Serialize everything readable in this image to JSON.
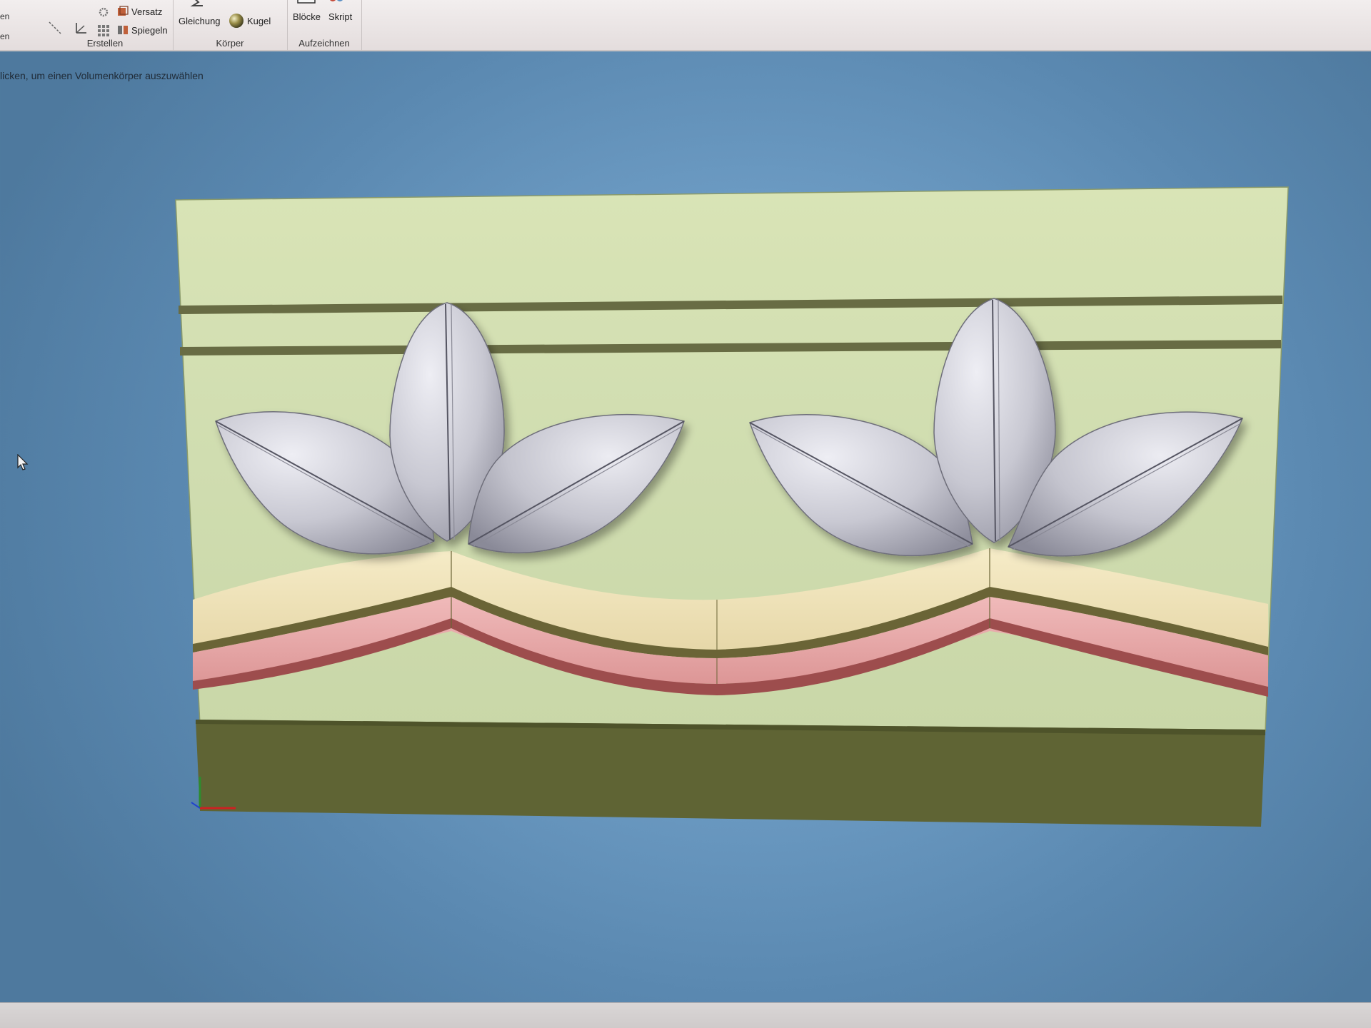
{
  "ribbon": {
    "left_edge": [
      "en",
      "en"
    ],
    "groups": [
      {
        "title": "Erstellen",
        "buttons": [
          {
            "label": "Versatz",
            "icon": "offset-icon"
          },
          {
            "label": "Spiegeln",
            "icon": "mirror-icon"
          }
        ]
      },
      {
        "title": "Körper",
        "buttons": [
          {
            "label": "Gleichung",
            "icon": "equation-icon"
          },
          {
            "label": "Kugel",
            "icon": "sphere-icon"
          }
        ]
      },
      {
        "title": "Aufzeichnen",
        "buttons": [
          {
            "label": "Blöcke",
            "icon": "blocks-icon"
          },
          {
            "label": "Skript",
            "icon": "script-icon"
          }
        ]
      }
    ]
  },
  "status": {
    "prompt": "licken, um einen Volumenkörper auszuwählen"
  },
  "colors": {
    "background": "#6f9ec6",
    "panel": "#d2dfb0",
    "dark_band": "#5f6434",
    "leaf": "#c8c8d0",
    "ribbon_cream": "#f1e6c2",
    "ribbon_pink": "#e7a6a6",
    "ribbon_dark": "#9d4d4d"
  }
}
